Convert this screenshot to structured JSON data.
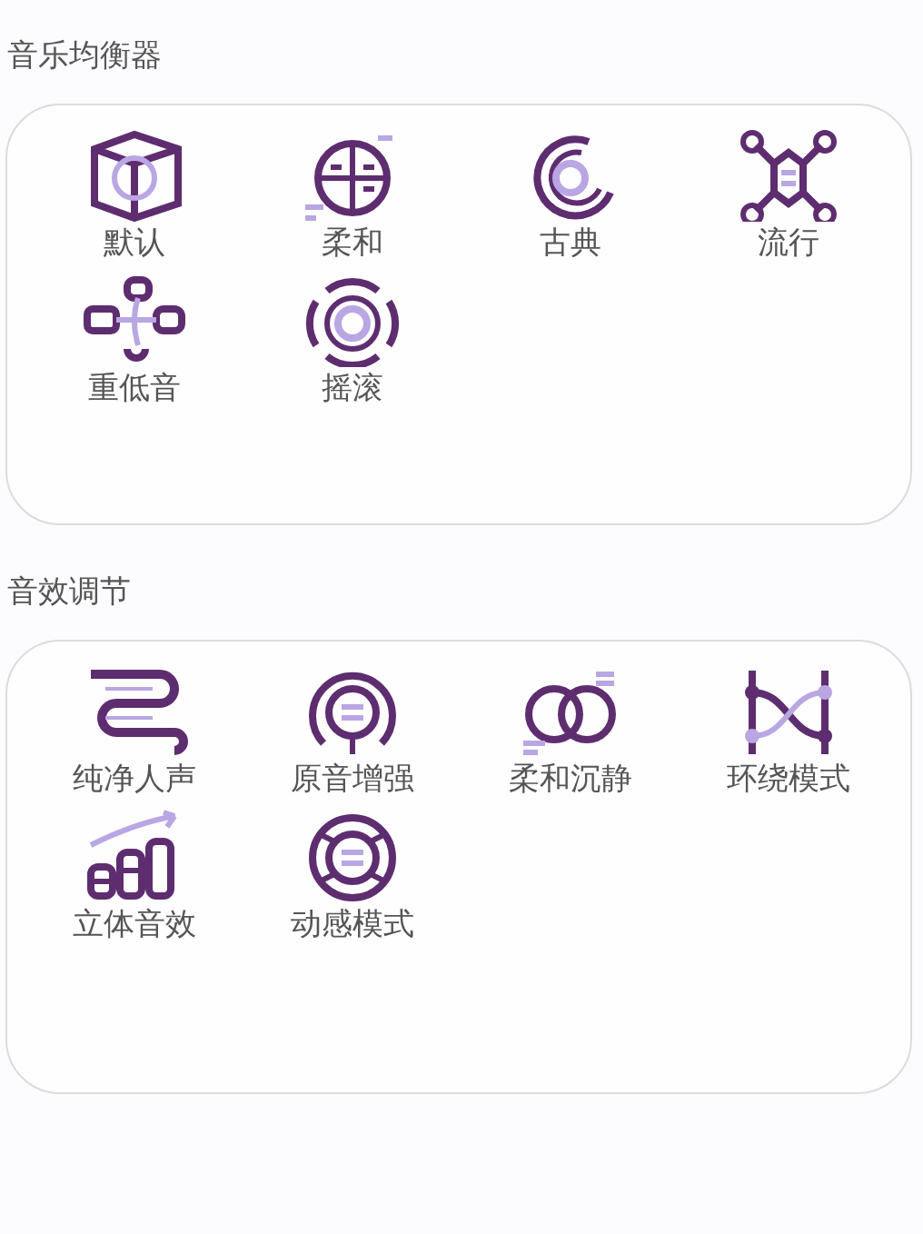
{
  "sections": [
    {
      "title": "音乐均衡器",
      "items": [
        {
          "label": "默认"
        },
        {
          "label": "柔和"
        },
        {
          "label": "古典"
        },
        {
          "label": "流行"
        },
        {
          "label": "重低音"
        },
        {
          "label": "摇滚"
        }
      ]
    },
    {
      "title": "音效调节",
      "items": [
        {
          "label": "纯净人声"
        },
        {
          "label": "原音增强"
        },
        {
          "label": "柔和沉静"
        },
        {
          "label": "环绕模式"
        },
        {
          "label": "立体音效"
        },
        {
          "label": "动感模式"
        }
      ]
    }
  ]
}
